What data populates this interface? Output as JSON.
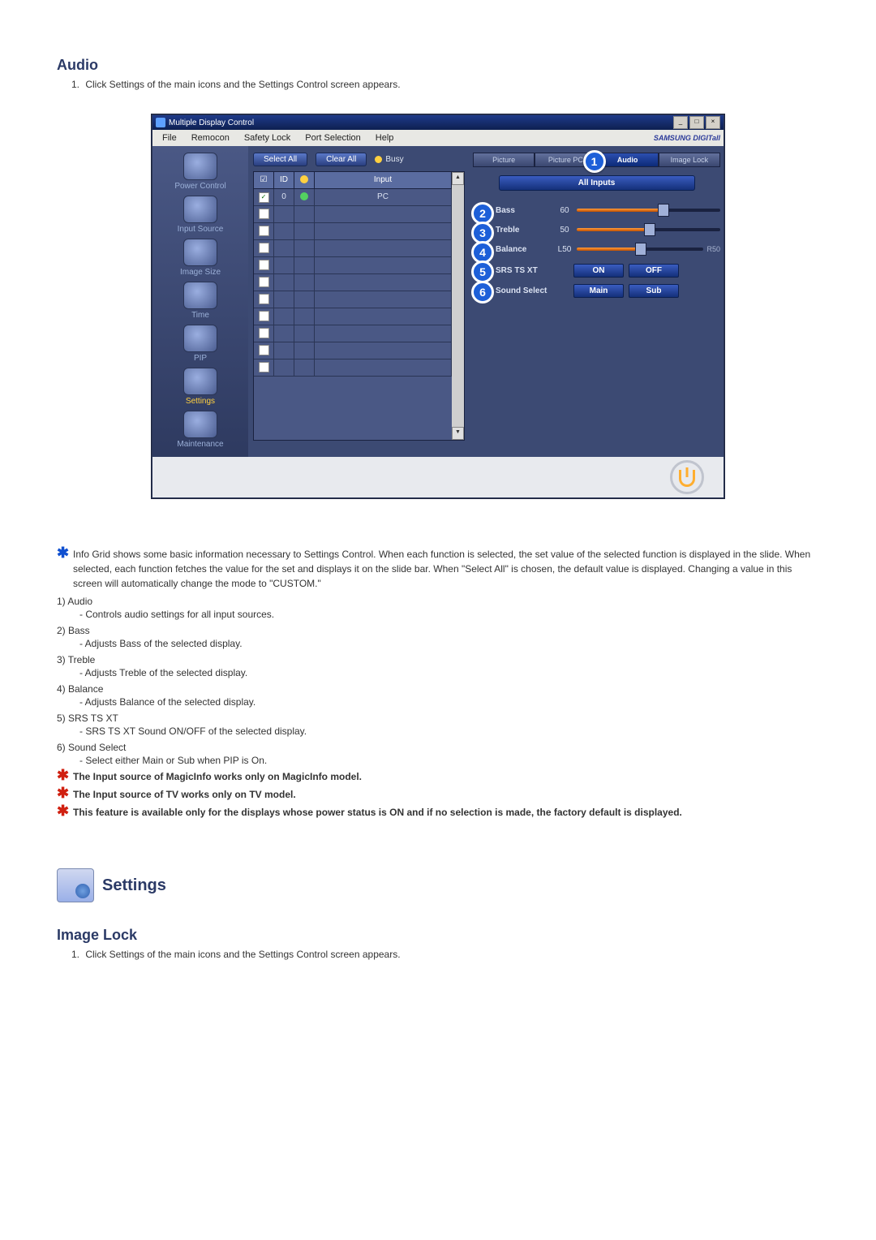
{
  "section1": {
    "title": "Audio",
    "intro_num": "1.",
    "intro": "Click Settings of the main icons and the Settings Control screen appears."
  },
  "window": {
    "title": "Multiple Display Control",
    "menus": [
      "File",
      "Remocon",
      "Safety Lock",
      "Port Selection",
      "Help"
    ],
    "brand": "SAMSUNG DIGITall",
    "sidebar": [
      {
        "label": "Power Control"
      },
      {
        "label": "Input Source"
      },
      {
        "label": "Image Size"
      },
      {
        "label": "Time"
      },
      {
        "label": "PIP"
      },
      {
        "label": "Settings",
        "active": true
      },
      {
        "label": "Maintenance"
      }
    ],
    "buttons": {
      "select_all": "Select All",
      "clear_all": "Clear All",
      "busy": "Busy"
    },
    "grid": {
      "headers": {
        "check": "☑",
        "id": "ID",
        "status": "",
        "input": "Input"
      },
      "rows": [
        {
          "checked": true,
          "id": "0",
          "status": "green",
          "input": "PC"
        },
        {
          "checked": false,
          "id": "",
          "status": "",
          "input": ""
        },
        {
          "checked": false,
          "id": "",
          "status": "",
          "input": ""
        },
        {
          "checked": false,
          "id": "",
          "status": "",
          "input": ""
        },
        {
          "checked": false,
          "id": "",
          "status": "",
          "input": ""
        },
        {
          "checked": false,
          "id": "",
          "status": "",
          "input": ""
        },
        {
          "checked": false,
          "id": "",
          "status": "",
          "input": ""
        },
        {
          "checked": false,
          "id": "",
          "status": "",
          "input": ""
        },
        {
          "checked": false,
          "id": "",
          "status": "",
          "input": ""
        },
        {
          "checked": false,
          "id": "",
          "status": "",
          "input": ""
        },
        {
          "checked": false,
          "id": "",
          "status": "",
          "input": ""
        }
      ]
    },
    "tabs": [
      {
        "label": "Picture"
      },
      {
        "label": "Picture PC"
      },
      {
        "label": "Audio",
        "active": true,
        "num": "1"
      },
      {
        "label": "Image Lock"
      }
    ],
    "allinputs": "All Inputs",
    "sliders": [
      {
        "num": "2",
        "label": "Bass",
        "value": "60",
        "fill": 60,
        "thumb": 60
      },
      {
        "num": "3",
        "label": "Treble",
        "value": "50",
        "fill": 50,
        "thumb": 50
      },
      {
        "num": "4",
        "label": "Balance",
        "value": "L50",
        "fill": 50,
        "thumb": 50,
        "right": "R50"
      }
    ],
    "modes": [
      {
        "num": "5",
        "label": "SRS TS XT",
        "opt1": "ON",
        "opt2": "OFF"
      },
      {
        "num": "6",
        "label": "Sound Select",
        "opt1": "Main",
        "opt2": "Sub"
      }
    ]
  },
  "desc": {
    "info": "Info Grid shows some basic information necessary to Settings Control. When each function is selected, the set value of the selected function is displayed in the slide. When selected, each function fetches the value for the set and displays it on the slide bar. When \"Select All\" is chosen, the default value is displayed. Changing a value in this screen will automatically change the mode to \"CUSTOM.\"",
    "items": [
      {
        "n": "1)",
        "title": "Audio",
        "sub": "- Controls audio settings for all input sources."
      },
      {
        "n": "2)",
        "title": "Bass",
        "sub": "- Adjusts Bass of the selected display."
      },
      {
        "n": "3)",
        "title": "Treble",
        "sub": "- Adjusts Treble of the selected display."
      },
      {
        "n": "4)",
        "title": "Balance",
        "sub": "- Adjusts Balance of the selected display."
      },
      {
        "n": "5)",
        "title": "SRS TS XT",
        "sub": "- SRS TS XT Sound ON/OFF of the selected display."
      },
      {
        "n": "6)",
        "title": "Sound Select",
        "sub": "- Select either Main or Sub when PIP is On."
      }
    ],
    "notes": [
      "The Input source of MagicInfo works only on MagicInfo model.",
      "The Input source of TV works only on TV model.",
      "This feature is available only for the displays whose power status is ON and if no selection is made, the factory default is displayed."
    ]
  },
  "section2": {
    "head": "Settings",
    "title": "Image Lock",
    "intro_num": "1.",
    "intro": "Click Settings of the main icons and the Settings Control screen appears."
  }
}
